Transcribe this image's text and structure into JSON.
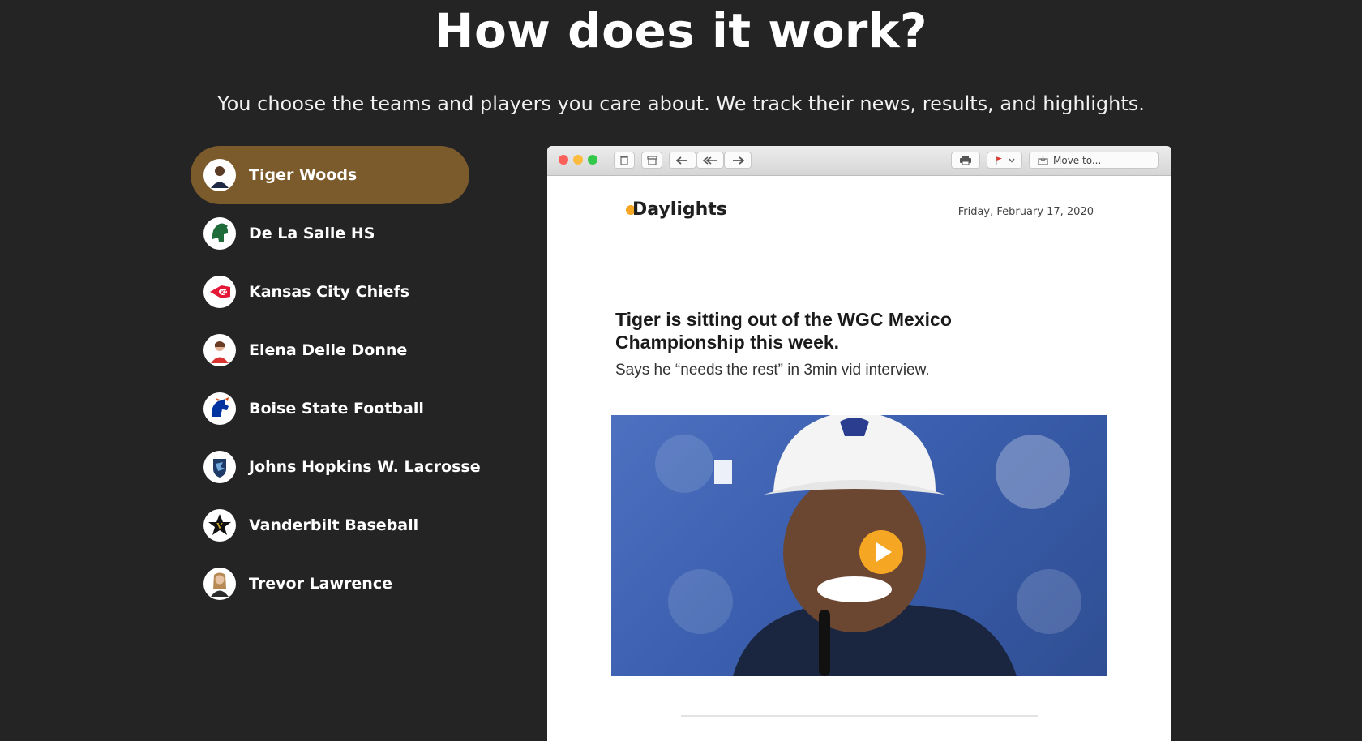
{
  "hero": {
    "title": "How does it work?",
    "subtitle": "You choose the teams and players you care about. We track their news, results, and highlights."
  },
  "sidebar": {
    "items": [
      {
        "label": "Tiger Woods",
        "icon": "golfer-avatar-icon",
        "active": true
      },
      {
        "label": "De La Salle HS",
        "icon": "spartan-helmet-icon",
        "active": false
      },
      {
        "label": "Kansas City Chiefs",
        "icon": "chiefs-arrowhead-icon",
        "active": false
      },
      {
        "label": "Elena Delle Donne",
        "icon": "player-avatar-icon",
        "active": false
      },
      {
        "label": "Boise State Football",
        "icon": "bronco-icon",
        "active": false
      },
      {
        "label": "Johns Hopkins W. Lacrosse",
        "icon": "blue-jay-icon",
        "active": false
      },
      {
        "label": "Vanderbilt Baseball",
        "icon": "star-v-icon",
        "active": false
      },
      {
        "label": "Trevor Lawrence",
        "icon": "player-avatar-icon",
        "active": false
      }
    ]
  },
  "mail": {
    "toolbar": {
      "move_to": "Move to..."
    },
    "brand": "Daylights",
    "date": "Friday, February 17, 2020",
    "headline": "Tiger is sitting out of the WGC Mexico Championship this week.",
    "subline": "Says he “needs the rest” in 3min vid interview."
  },
  "colors": {
    "background": "#242424",
    "active_item": "#7b5b2c",
    "play_button": "#f5a623",
    "video_background": "#3b5fae"
  }
}
